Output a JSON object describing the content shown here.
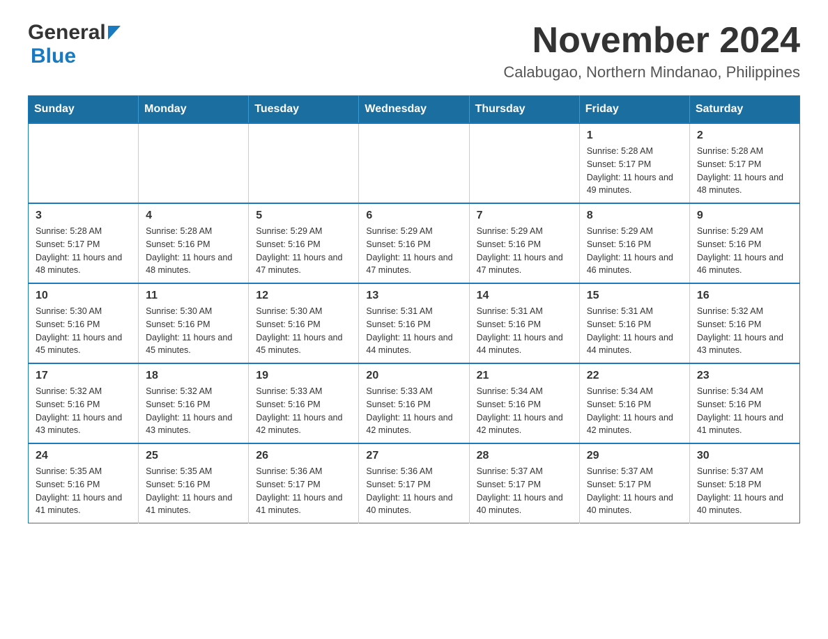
{
  "header": {
    "logo_general": "General",
    "logo_blue": "Blue",
    "title": "November 2024",
    "subtitle": "Calabugao, Northern Mindanao, Philippines"
  },
  "calendar": {
    "days_of_week": [
      "Sunday",
      "Monday",
      "Tuesday",
      "Wednesday",
      "Thursday",
      "Friday",
      "Saturday"
    ],
    "weeks": [
      [
        {
          "day": "",
          "sunrise": "",
          "sunset": "",
          "daylight": ""
        },
        {
          "day": "",
          "sunrise": "",
          "sunset": "",
          "daylight": ""
        },
        {
          "day": "",
          "sunrise": "",
          "sunset": "",
          "daylight": ""
        },
        {
          "day": "",
          "sunrise": "",
          "sunset": "",
          "daylight": ""
        },
        {
          "day": "",
          "sunrise": "",
          "sunset": "",
          "daylight": ""
        },
        {
          "day": "1",
          "sunrise": "Sunrise: 5:28 AM",
          "sunset": "Sunset: 5:17 PM",
          "daylight": "Daylight: 11 hours and 49 minutes."
        },
        {
          "day": "2",
          "sunrise": "Sunrise: 5:28 AM",
          "sunset": "Sunset: 5:17 PM",
          "daylight": "Daylight: 11 hours and 48 minutes."
        }
      ],
      [
        {
          "day": "3",
          "sunrise": "Sunrise: 5:28 AM",
          "sunset": "Sunset: 5:17 PM",
          "daylight": "Daylight: 11 hours and 48 minutes."
        },
        {
          "day": "4",
          "sunrise": "Sunrise: 5:28 AM",
          "sunset": "Sunset: 5:16 PM",
          "daylight": "Daylight: 11 hours and 48 minutes."
        },
        {
          "day": "5",
          "sunrise": "Sunrise: 5:29 AM",
          "sunset": "Sunset: 5:16 PM",
          "daylight": "Daylight: 11 hours and 47 minutes."
        },
        {
          "day": "6",
          "sunrise": "Sunrise: 5:29 AM",
          "sunset": "Sunset: 5:16 PM",
          "daylight": "Daylight: 11 hours and 47 minutes."
        },
        {
          "day": "7",
          "sunrise": "Sunrise: 5:29 AM",
          "sunset": "Sunset: 5:16 PM",
          "daylight": "Daylight: 11 hours and 47 minutes."
        },
        {
          "day": "8",
          "sunrise": "Sunrise: 5:29 AM",
          "sunset": "Sunset: 5:16 PM",
          "daylight": "Daylight: 11 hours and 46 minutes."
        },
        {
          "day": "9",
          "sunrise": "Sunrise: 5:29 AM",
          "sunset": "Sunset: 5:16 PM",
          "daylight": "Daylight: 11 hours and 46 minutes."
        }
      ],
      [
        {
          "day": "10",
          "sunrise": "Sunrise: 5:30 AM",
          "sunset": "Sunset: 5:16 PM",
          "daylight": "Daylight: 11 hours and 45 minutes."
        },
        {
          "day": "11",
          "sunrise": "Sunrise: 5:30 AM",
          "sunset": "Sunset: 5:16 PM",
          "daylight": "Daylight: 11 hours and 45 minutes."
        },
        {
          "day": "12",
          "sunrise": "Sunrise: 5:30 AM",
          "sunset": "Sunset: 5:16 PM",
          "daylight": "Daylight: 11 hours and 45 minutes."
        },
        {
          "day": "13",
          "sunrise": "Sunrise: 5:31 AM",
          "sunset": "Sunset: 5:16 PM",
          "daylight": "Daylight: 11 hours and 44 minutes."
        },
        {
          "day": "14",
          "sunrise": "Sunrise: 5:31 AM",
          "sunset": "Sunset: 5:16 PM",
          "daylight": "Daylight: 11 hours and 44 minutes."
        },
        {
          "day": "15",
          "sunrise": "Sunrise: 5:31 AM",
          "sunset": "Sunset: 5:16 PM",
          "daylight": "Daylight: 11 hours and 44 minutes."
        },
        {
          "day": "16",
          "sunrise": "Sunrise: 5:32 AM",
          "sunset": "Sunset: 5:16 PM",
          "daylight": "Daylight: 11 hours and 43 minutes."
        }
      ],
      [
        {
          "day": "17",
          "sunrise": "Sunrise: 5:32 AM",
          "sunset": "Sunset: 5:16 PM",
          "daylight": "Daylight: 11 hours and 43 minutes."
        },
        {
          "day": "18",
          "sunrise": "Sunrise: 5:32 AM",
          "sunset": "Sunset: 5:16 PM",
          "daylight": "Daylight: 11 hours and 43 minutes."
        },
        {
          "day": "19",
          "sunrise": "Sunrise: 5:33 AM",
          "sunset": "Sunset: 5:16 PM",
          "daylight": "Daylight: 11 hours and 42 minutes."
        },
        {
          "day": "20",
          "sunrise": "Sunrise: 5:33 AM",
          "sunset": "Sunset: 5:16 PM",
          "daylight": "Daylight: 11 hours and 42 minutes."
        },
        {
          "day": "21",
          "sunrise": "Sunrise: 5:34 AM",
          "sunset": "Sunset: 5:16 PM",
          "daylight": "Daylight: 11 hours and 42 minutes."
        },
        {
          "day": "22",
          "sunrise": "Sunrise: 5:34 AM",
          "sunset": "Sunset: 5:16 PM",
          "daylight": "Daylight: 11 hours and 42 minutes."
        },
        {
          "day": "23",
          "sunrise": "Sunrise: 5:34 AM",
          "sunset": "Sunset: 5:16 PM",
          "daylight": "Daylight: 11 hours and 41 minutes."
        }
      ],
      [
        {
          "day": "24",
          "sunrise": "Sunrise: 5:35 AM",
          "sunset": "Sunset: 5:16 PM",
          "daylight": "Daylight: 11 hours and 41 minutes."
        },
        {
          "day": "25",
          "sunrise": "Sunrise: 5:35 AM",
          "sunset": "Sunset: 5:16 PM",
          "daylight": "Daylight: 11 hours and 41 minutes."
        },
        {
          "day": "26",
          "sunrise": "Sunrise: 5:36 AM",
          "sunset": "Sunset: 5:17 PM",
          "daylight": "Daylight: 11 hours and 41 minutes."
        },
        {
          "day": "27",
          "sunrise": "Sunrise: 5:36 AM",
          "sunset": "Sunset: 5:17 PM",
          "daylight": "Daylight: 11 hours and 40 minutes."
        },
        {
          "day": "28",
          "sunrise": "Sunrise: 5:37 AM",
          "sunset": "Sunset: 5:17 PM",
          "daylight": "Daylight: 11 hours and 40 minutes."
        },
        {
          "day": "29",
          "sunrise": "Sunrise: 5:37 AM",
          "sunset": "Sunset: 5:17 PM",
          "daylight": "Daylight: 11 hours and 40 minutes."
        },
        {
          "day": "30",
          "sunrise": "Sunrise: 5:37 AM",
          "sunset": "Sunset: 5:18 PM",
          "daylight": "Daylight: 11 hours and 40 minutes."
        }
      ]
    ]
  }
}
